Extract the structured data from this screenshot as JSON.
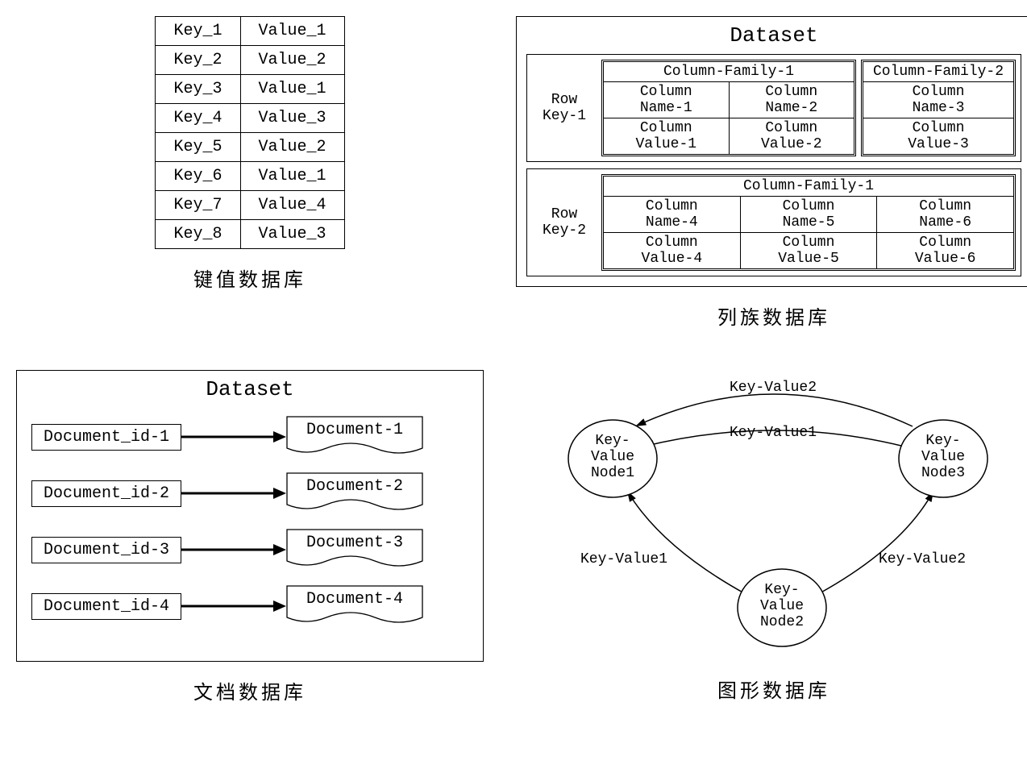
{
  "kv": {
    "caption": "键值数据库",
    "rows": [
      {
        "k": "Key_1",
        "v": "Value_1"
      },
      {
        "k": "Key_2",
        "v": "Value_2"
      },
      {
        "k": "Key_3",
        "v": "Value_1"
      },
      {
        "k": "Key_4",
        "v": "Value_3"
      },
      {
        "k": "Key_5",
        "v": "Value_2"
      },
      {
        "k": "Key_6",
        "v": "Value_1"
      },
      {
        "k": "Key_7",
        "v": "Value_4"
      },
      {
        "k": "Key_8",
        "v": "Value_3"
      }
    ]
  },
  "cf": {
    "caption": "列族数据库",
    "title": "Dataset",
    "rows": [
      {
        "rowkey": "Row\nKey-1",
        "families": [
          {
            "name": "Column-Family-1",
            "names": [
              "Column\nName-1",
              "Column\nName-2"
            ],
            "values": [
              "Column\nValue-1",
              "Column\nValue-2"
            ]
          },
          {
            "name": "Column-Family-2",
            "names": [
              "Column\nName-3"
            ],
            "values": [
              "Column\nValue-3"
            ]
          }
        ]
      },
      {
        "rowkey": "Row\nKey-2",
        "families": [
          {
            "name": "Column-Family-1",
            "names": [
              "Column\nName-4",
              "Column\nName-5",
              "Column\nName-6"
            ],
            "values": [
              "Column\nValue-4",
              "Column\nValue-5",
              "Column\nValue-6"
            ]
          }
        ]
      }
    ]
  },
  "doc": {
    "caption": "文档数据库",
    "title": "Dataset",
    "rows": [
      {
        "id": "Document_id-1",
        "doc": "Document-1"
      },
      {
        "id": "Document_id-2",
        "doc": "Document-2"
      },
      {
        "id": "Document_id-3",
        "doc": "Document-3"
      },
      {
        "id": "Document_id-4",
        "doc": "Document-4"
      }
    ]
  },
  "graph": {
    "caption": "图形数据库",
    "nodes": {
      "n1": "Key-\nValue\nNode1",
      "n2": "Key-\nValue\nNode2",
      "n3": "Key-\nValue\nNode3"
    },
    "edges": {
      "e_n3_n1_top": "Key-Value2",
      "e_n3_n1_bot": "Key-Value1",
      "e_n2_n1": "Key-Value1",
      "e_n2_n3": "Key-Value2"
    }
  }
}
